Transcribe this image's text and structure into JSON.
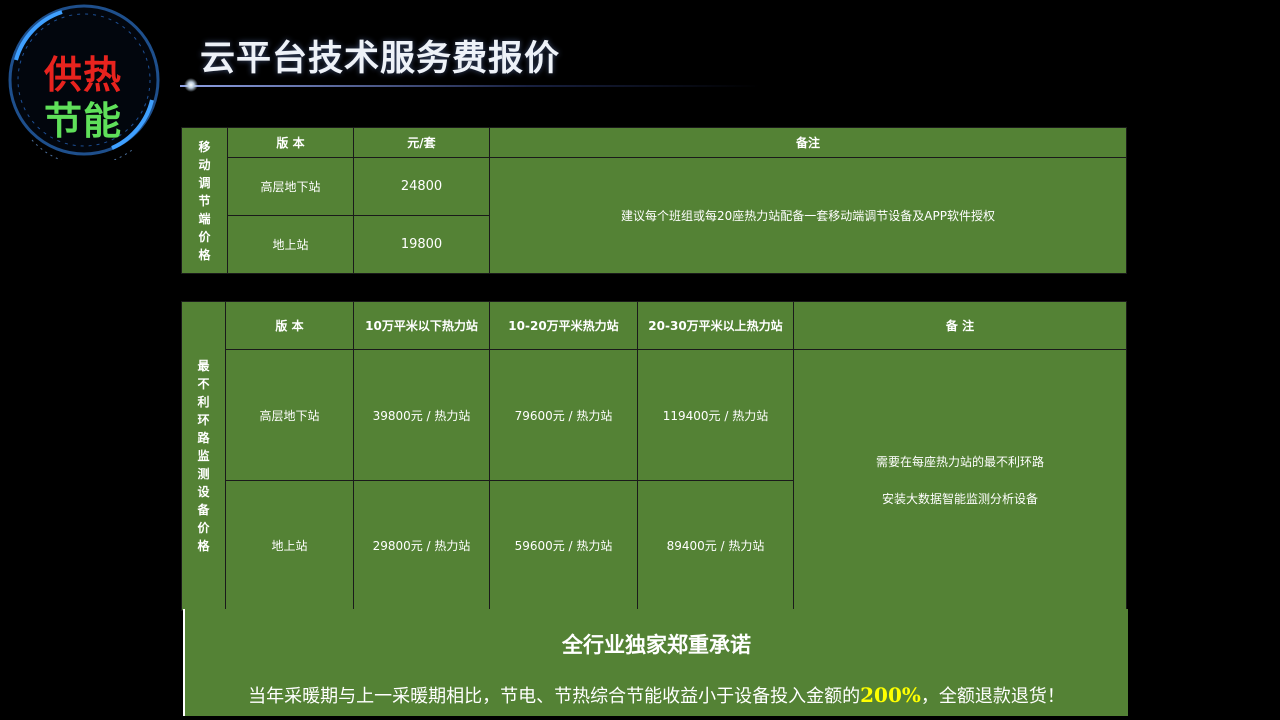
{
  "logo": {
    "line1": "供热",
    "line2": "节能"
  },
  "page_title": "云平台技术服务费报价",
  "table1": {
    "side_label": "移动调节端价格",
    "headers": [
      "版 本",
      "元/套",
      "备注"
    ],
    "rows": [
      {
        "version": "高层地下站",
        "price": "24800"
      },
      {
        "version": "地上站",
        "price": "19800"
      }
    ],
    "note": "建议每个班组或每20座热力站配备一套移动端调节设备及APP软件授权"
  },
  "table2": {
    "side_label": "最不利环路监测设备价格",
    "headers": [
      "版 本",
      "10万平米以下热力站",
      "10-20万平米热力站",
      "20-30万平米以上热力站",
      "备 注"
    ],
    "rows": [
      {
        "version": "高层地下站",
        "c1": "39800元 / 热力站",
        "c2": "79600元 / 热力站",
        "c3": "119400元 / 热力站"
      },
      {
        "version": "地上站",
        "c1": "29800元 / 热力站",
        "c2": "59600元 / 热力站",
        "c3": "89400元 / 热力站"
      }
    ],
    "note_line1": "需要在每座热力站的最不利环路",
    "note_line2": "安装大数据智能监测分析设备"
  },
  "promise": {
    "title": "全行业独家郑重承诺",
    "text_before": "当年采暖期与上一采暖期相比，节电、节热综合节能收益小于设备投入金额的",
    "highlight": "200%",
    "text_after": "，全额退款退货！"
  },
  "colors": {
    "table_green": "#548235",
    "logo_red": "#e8231e",
    "logo_green": "#5fe05a",
    "highlight": "#ffff00"
  }
}
